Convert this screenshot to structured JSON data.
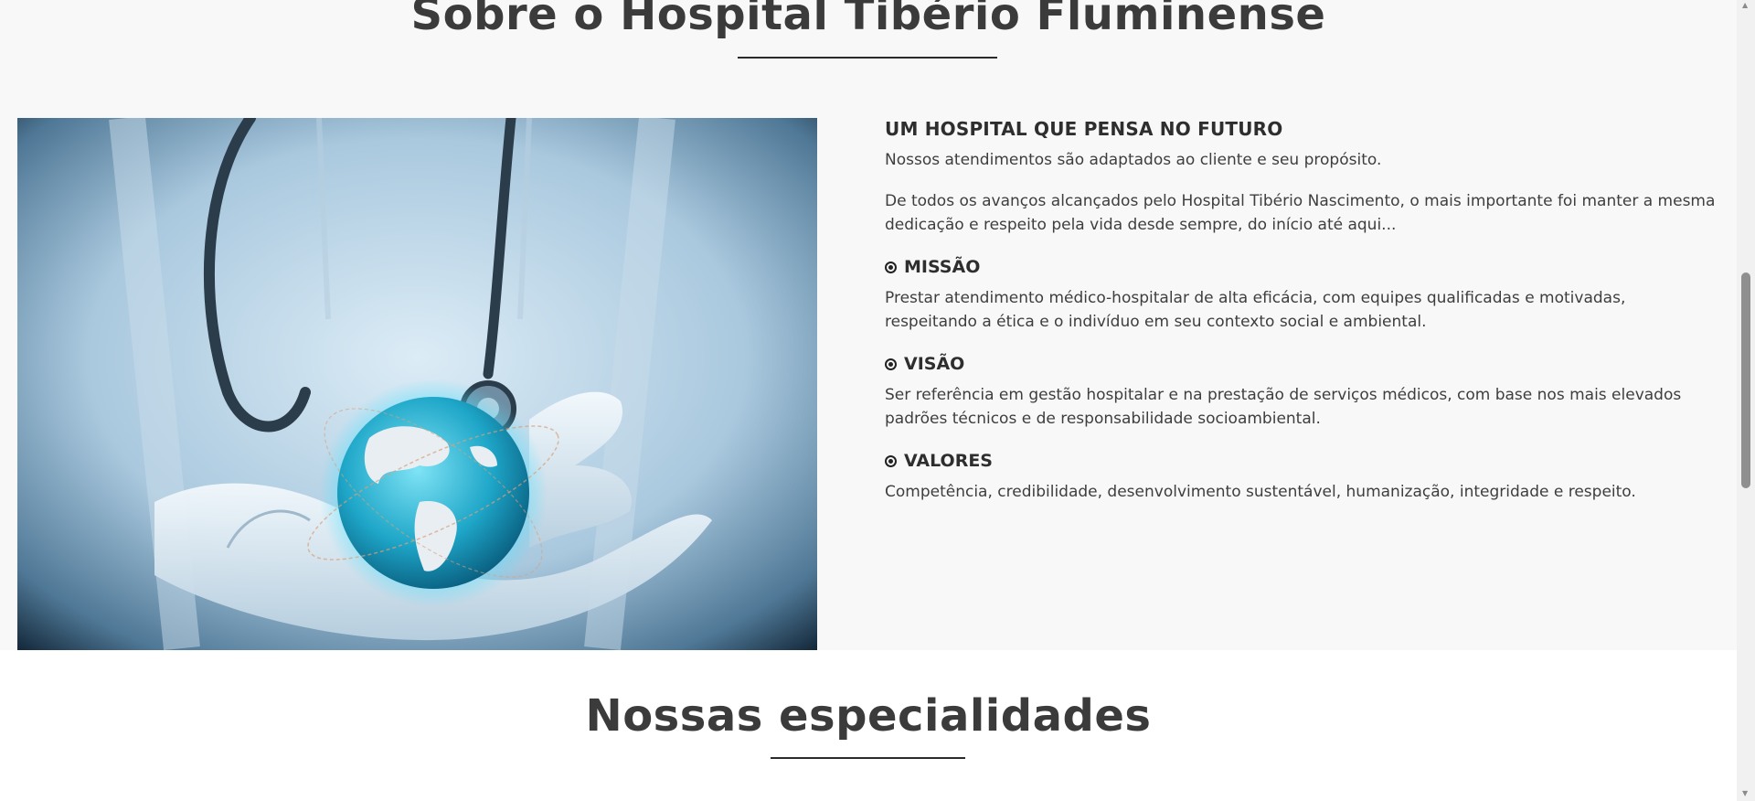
{
  "about": {
    "title": "Sobre o Hospital Tibério Fluminense",
    "heading": "UM HOSPITAL QUE PENSA NO FUTURO",
    "intro": "Nossos atendimentos são adaptados ao cliente e seu propósito.",
    "paragraph": "De todos os avanços alcançados pelo Hospital Tibério Nascimento, o mais importante foi manter a mesma dedicação e respeito pela vida desde sempre, do início até aqui...",
    "items": [
      {
        "title": "MISSÃO",
        "text": "Prestar atendimento médico-hospitalar de alta eficácia, com equipes qualificadas e motivadas, respeitando a ética e o indivíduo em seu contexto social e ambiental."
      },
      {
        "title": "VISÃO",
        "text": "Ser referência em gestão hospitalar e na prestação de serviços médicos, com base nos mais elevados padrões técnicos e de responsabilidade socioambiental."
      },
      {
        "title": "VALORES",
        "text": "Competência, credibilidade, desenvolvimento sustentável, humanização, integridade e respeito."
      }
    ],
    "image_icon": "doctor-holding-globe-image",
    "bullet_icon": "radio-bullet-icon"
  },
  "specialties": {
    "title": "Nossas especialidades"
  },
  "colors": {
    "section_bg": "#f8f8f8",
    "page_bg": "#ffffff",
    "text": "#3e3e3e",
    "accent_blue": "#2ab8d8"
  }
}
